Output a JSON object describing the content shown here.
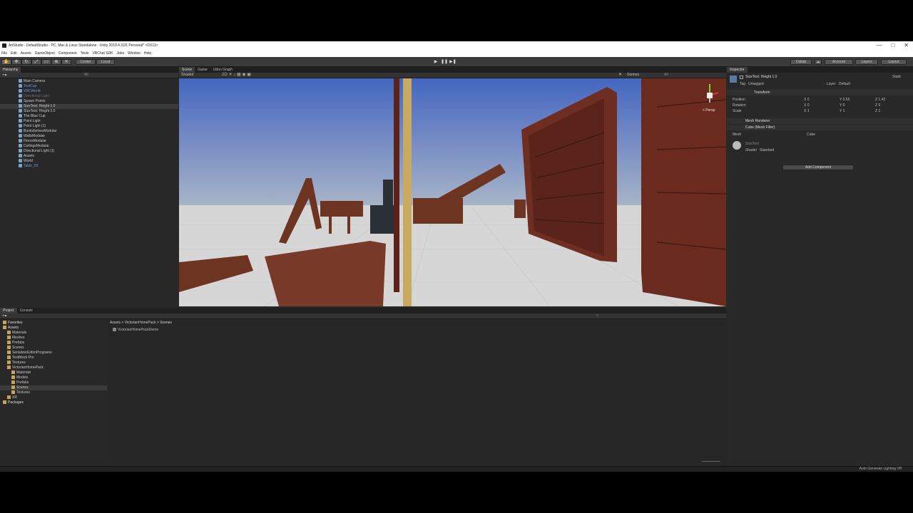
{
  "window": {
    "title": "ArtStudio - DefaultStudio - PC, Mac & Linux Standalone - Unity 2019.4.31f1 Personal* <DX11>",
    "buttons": [
      "—",
      "□",
      "✕"
    ]
  },
  "menu": [
    "File",
    "Edit",
    "Assets",
    "GameObject",
    "Component",
    "Tools",
    "VRChat SDK",
    "Jobs",
    "Window",
    "Help"
  ],
  "toolbar": {
    "pivot": "Center",
    "space": "Local",
    "collab": "Collab",
    "account": "Account",
    "layers": "Layers",
    "layout": "Layout",
    "play_icons": [
      "▶",
      "❚❚",
      "▶❚"
    ]
  },
  "hierarchy": {
    "tab": "Hierarchy",
    "search": "All",
    "rows": [
      {
        "label": "DefaultStudio*",
        "depth": 0,
        "style": "scene"
      },
      {
        "label": "Main Camera",
        "depth": 1,
        "style": ""
      },
      {
        "label": "TestCup",
        "depth": 1,
        "style": "blue"
      },
      {
        "label": "VRCWorld",
        "depth": 1,
        "style": "blue"
      },
      {
        "label": "Directional Light",
        "depth": 1,
        "style": "dim"
      },
      {
        "label": "Spawn Points",
        "depth": 1,
        "style": ""
      },
      {
        "label": "SizeTest: Height 1.0",
        "depth": 1,
        "style": "sel"
      },
      {
        "label": "SizeTest: Height 2.0",
        "depth": 1,
        "style": ""
      },
      {
        "label": "The Blue Cup",
        "depth": 1,
        "style": ""
      },
      {
        "label": "Point Light",
        "depth": 1,
        "style": ""
      },
      {
        "label": "Point Light (1)",
        "depth": 1,
        "style": ""
      },
      {
        "label": "BookshelvesModular",
        "depth": 1,
        "style": ""
      },
      {
        "label": "WallsModular",
        "depth": 1,
        "style": ""
      },
      {
        "label": "FloorsModular",
        "depth": 1,
        "style": ""
      },
      {
        "label": "CeilingsModular",
        "depth": 1,
        "style": ""
      },
      {
        "label": "Directional Light (1)",
        "depth": 1,
        "style": ""
      },
      {
        "label": "Assets",
        "depth": 1,
        "style": ""
      },
      {
        "label": "World",
        "depth": 1,
        "style": ""
      },
      {
        "label": "Table_03",
        "depth": 1,
        "style": "blue"
      }
    ]
  },
  "scene": {
    "tabs": [
      "Scene",
      "Game",
      "Udon Graph"
    ],
    "shading": "Shaded",
    "gizmos": "Gizmos",
    "search": "All",
    "persp_label": "< Persp"
  },
  "project": {
    "tabs": [
      "Project",
      "Console"
    ],
    "tree": [
      {
        "label": "Favorites",
        "depth": 0,
        "bold": true
      },
      {
        "label": "Assets",
        "depth": 0,
        "bold": true
      },
      {
        "label": "Materials",
        "depth": 1
      },
      {
        "label": "Meshes",
        "depth": 1
      },
      {
        "label": "Prefabs",
        "depth": 1
      },
      {
        "label": "Scenes",
        "depth": 1
      },
      {
        "label": "SerializedUdonPrograms",
        "depth": 1
      },
      {
        "label": "TextMesh Pro",
        "depth": 1
      },
      {
        "label": "Textures",
        "depth": 1
      },
      {
        "label": "VictorianHomePack",
        "depth": 1
      },
      {
        "label": "Materials",
        "depth": 2
      },
      {
        "label": "Models",
        "depth": 2
      },
      {
        "label": "Prefabs",
        "depth": 2
      },
      {
        "label": "Scenes",
        "depth": 2,
        "sel": true
      },
      {
        "label": "Textures",
        "depth": 2
      },
      {
        "label": "XR",
        "depth": 1
      },
      {
        "label": "Packages",
        "depth": 0,
        "bold": true
      }
    ],
    "breadcrumb": [
      "Assets",
      "VictorianHomePack",
      "Scenes"
    ],
    "files": [
      "VictorianHomePackDemo"
    ]
  },
  "inspector": {
    "tab": "Inspector",
    "object_name": "SizeTest: Height 1.0",
    "static_label": "Static",
    "tag_label": "Tag",
    "tag_value": "Untagged",
    "layer_label": "Layer",
    "layer_value": "Default",
    "transform": {
      "title": "Transform",
      "position_label": "Position",
      "rotation_label": "Rotation",
      "scale_label": "Scale",
      "position": [
        "X 0",
        "Y 0.55",
        "Z 1.43"
      ],
      "rotation": [
        "X 0",
        "Y 0",
        "Z 0"
      ],
      "scale": [
        "X 1",
        "Y 1",
        "Z 1"
      ]
    },
    "mesh_renderer": "Mesh Renderer",
    "mesh_filter": "Cube (Mesh Filter)",
    "mesh_label": "Mesh",
    "mesh_value": "Cube",
    "material_name": "SizeText",
    "shader_label": "Shader",
    "shader_value": "Standard",
    "add_component": "Add Component"
  },
  "status": {
    "right": "Auto Generate Lighting Off"
  },
  "colors": {
    "sky_top": "#4466c0",
    "sky_bottom": "#a8b4c8",
    "ground": "#d6d6d6",
    "wood": "#7a3a2a",
    "selection": "#3a3a3a"
  }
}
